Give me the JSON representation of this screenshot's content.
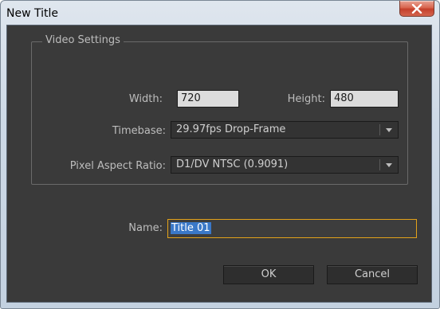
{
  "window": {
    "title": "New Title"
  },
  "video_settings": {
    "legend": "Video Settings",
    "width_label": "Width:",
    "width_value": "720",
    "height_label": "Height:",
    "height_value": "480",
    "timebase_label": "Timebase:",
    "timebase_value": "29.97fps Drop-Frame",
    "par_label": "Pixel Aspect Ratio:",
    "par_value": "D1/DV NTSC (0.9091)"
  },
  "name": {
    "label": "Name:",
    "value": "Title 01"
  },
  "buttons": {
    "ok": "OK",
    "cancel": "Cancel"
  },
  "colors": {
    "dialog_bg": "#3a3a3a",
    "focus_border": "#e3a21a",
    "selection": "#3a78c8",
    "close_button": "#c4402b"
  },
  "icons": {
    "close": "close-x-icon",
    "dropdown": "chevron-down-icon"
  }
}
